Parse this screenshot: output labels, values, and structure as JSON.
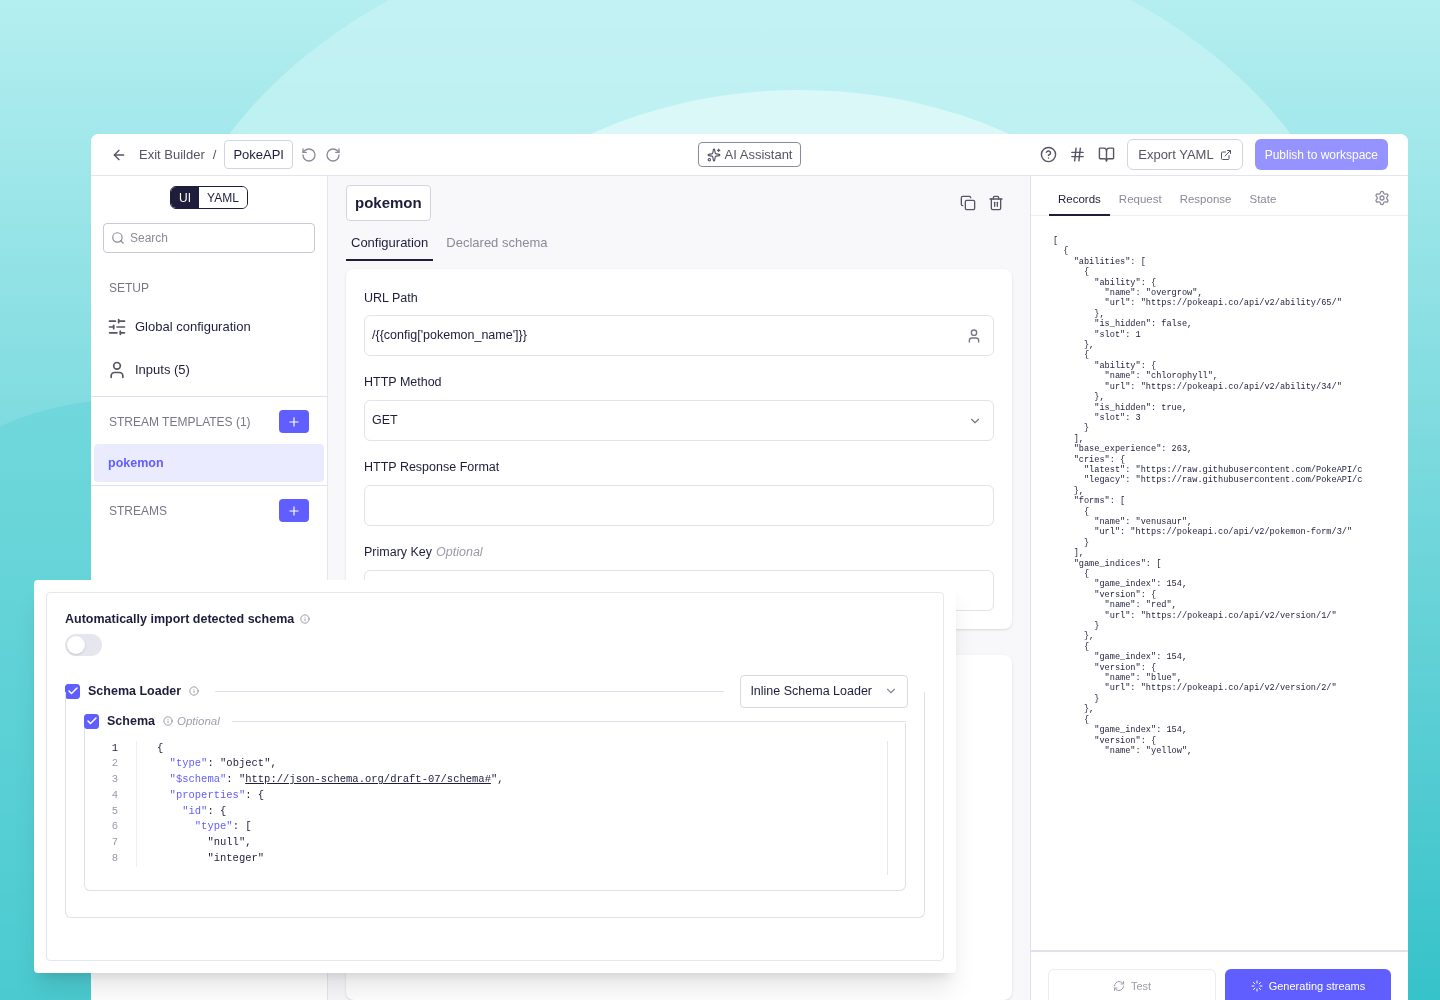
{
  "header": {
    "back_link": "Exit Builder",
    "separator": "/",
    "project_name": "PokeAPI",
    "ai_button": "AI Assistant",
    "export_button": "Export YAML",
    "publish_button": {
      "label": "Publish to workspace",
      "disabled": true
    }
  },
  "sidebar": {
    "view_toggle": [
      {
        "label": "UI",
        "selected": true
      },
      {
        "label": "YAML",
        "selected": false
      }
    ],
    "search": {
      "placeholder": "Search"
    },
    "setup_heading": "SETUP",
    "setup_items": [
      {
        "kind": "config",
        "label": "Global configuration"
      },
      {
        "kind": "inputs",
        "label": "Inputs (5)"
      }
    ],
    "sections": [
      {
        "heading": "STREAM TEMPLATES (1)",
        "items": [
          {
            "label": "pokemon",
            "selected": true
          }
        ]
      },
      {
        "heading": "STREAMS"
      }
    ]
  },
  "editor": {
    "stream_name": "pokemon",
    "tabs": [
      {
        "label": "Configuration",
        "selected": true
      },
      {
        "label": "Declared schema",
        "selected": false
      }
    ],
    "fields": [
      {
        "kind": "user_input",
        "label": "URL Path",
        "value": "/{{config['pokemon_name']}}"
      },
      {
        "kind": "select",
        "label": "HTTP Method",
        "value": "GET"
      },
      {
        "kind": "text",
        "label": "HTTP Response Format"
      },
      {
        "kind": "text",
        "label": "Primary Key",
        "optional": "Optional"
      }
    ]
  },
  "schema_panel": {
    "auto_import": {
      "label": "Automatically import detected schema",
      "on": false
    },
    "schema_loader": {
      "label": "Schema Loader",
      "checked": true,
      "loader_type": "Inline Schema Loader"
    },
    "schema": {
      "label": "Schema",
      "optional": "Optional",
      "checked": true,
      "lines": [
        {
          "number": "1",
          "segments": [
            {
              "kind": "plain",
              "text": "{"
            }
          ]
        },
        {
          "number": "2",
          "segments": [
            {
              "kind": "key",
              "text": "  \"type\""
            },
            {
              "kind": "plain",
              "text": ": \"object\","
            }
          ]
        },
        {
          "number": "3",
          "segments": [
            {
              "kind": "key",
              "text": "  \"$schema\""
            },
            {
              "kind": "plain",
              "text": ": \""
            },
            {
              "kind": "link",
              "text": "http://json-schema.org/draft-07/schema#"
            },
            {
              "kind": "plain",
              "text": "\","
            }
          ]
        },
        {
          "number": "4",
          "segments": [
            {
              "kind": "key",
              "text": "  \"properties\""
            },
            {
              "kind": "plain",
              "text": ": {"
            }
          ]
        },
        {
          "number": "5",
          "segments": [
            {
              "kind": "key",
              "text": "    \"id\""
            },
            {
              "kind": "plain",
              "text": ": {"
            }
          ]
        },
        {
          "number": "6",
          "segments": [
            {
              "kind": "key",
              "text": "      \"type\""
            },
            {
              "kind": "plain",
              "text": ": ["
            }
          ]
        },
        {
          "number": "7",
          "segments": [
            {
              "kind": "plain",
              "text": "        \"null\","
            }
          ]
        },
        {
          "number": "8",
          "segments": [
            {
              "kind": "plain",
              "text": "        \"integer\""
            }
          ]
        }
      ]
    }
  },
  "preview": {
    "tabs": [
      {
        "label": "Records",
        "selected": true
      },
      {
        "label": "Request",
        "selected": false
      },
      {
        "label": "Response",
        "selected": false
      },
      {
        "label": "State",
        "selected": false
      }
    ],
    "records": [
      "[",
      "  {",
      "    \"abilities\": [",
      "      {",
      "        \"ability\": {",
      "          \"name\": \"overgrow\",",
      "          \"url\": \"https://pokeapi.co/api/v2/ability/65/\"",
      "        },",
      "        \"is_hidden\": false,",
      "        \"slot\": 1",
      "      },",
      "      {",
      "        \"ability\": {",
      "          \"name\": \"chlorophyll\",",
      "          \"url\": \"https://pokeapi.co/api/v2/ability/34/\"",
      "        },",
      "        \"is_hidden\": true,",
      "        \"slot\": 3",
      "      }",
      "    ],",
      "    \"base_experience\": 263,",
      "    \"cries\": {",
      "      \"latest\": \"https://raw.githubusercontent.com/PokeAPI/c",
      "      \"legacy\": \"https://raw.githubusercontent.com/PokeAPI/c",
      "    },",
      "    \"forms\": [",
      "      {",
      "        \"name\": \"venusaur\",",
      "        \"url\": \"https://pokeapi.co/api/v2/pokemon-form/3/\"",
      "      }",
      "    ],",
      "    \"game_indices\": [",
      "      {",
      "        \"game_index\": 154,",
      "        \"version\": {",
      "          \"name\": \"red\",",
      "          \"url\": \"https://pokeapi.co/api/v2/version/1/\"",
      "        }",
      "      },",
      "      {",
      "        \"game_index\": 154,",
      "        \"version\": {",
      "          \"name\": \"blue\",",
      "          \"url\": \"https://pokeapi.co/api/v2/version/2/\"",
      "        }",
      "      },",
      "      {",
      "        \"game_index\": 154,",
      "        \"version\": {",
      "          \"name\": \"yellow\","
    ],
    "test_button": {
      "label": "Test",
      "disabled": true
    },
    "generate_button": {
      "label": "Generating streams",
      "busy": true
    }
  }
}
